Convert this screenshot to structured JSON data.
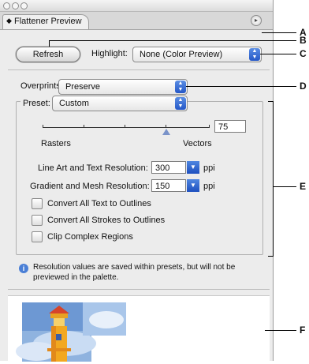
{
  "window": {
    "tab_label": "Flattener Preview"
  },
  "toolbar": {
    "refresh_label": "Refresh",
    "highlight_label": "Highlight:",
    "highlight_value": "None (Color Preview)"
  },
  "overprints": {
    "label": "Overprints:",
    "value": "Preserve"
  },
  "preset": {
    "label": "Preset:",
    "value": "Custom"
  },
  "slider": {
    "value": "75",
    "left_label": "Rasters",
    "right_label": "Vectors"
  },
  "resolution": {
    "line_art_label": "Line Art and Text Resolution:",
    "line_art_value": "300",
    "gradient_label": "Gradient and Mesh Resolution:",
    "gradient_value": "150",
    "unit": "ppi"
  },
  "options": [
    {
      "label": "Convert All Text to Outlines",
      "checked": false
    },
    {
      "label": "Convert All Strokes to Outlines",
      "checked": false
    },
    {
      "label": "Clip Complex Regions",
      "checked": false
    }
  ],
  "info": {
    "line1": "Resolution values are saved within presets, but will not be",
    "line2": "previewed in the palette."
  },
  "callouts": {
    "a": "A",
    "b": "B",
    "c": "C",
    "d": "D",
    "e": "E",
    "f": "F"
  },
  "colors": {
    "accent": "#2f63d0",
    "panel_bg": "#ececec"
  }
}
